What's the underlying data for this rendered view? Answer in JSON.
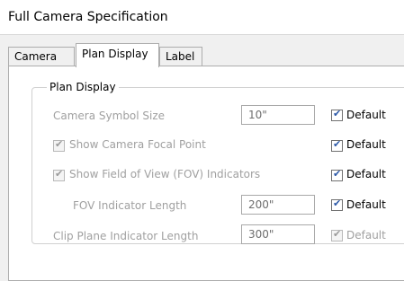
{
  "window": {
    "title": "Full Camera Specification"
  },
  "tabs": [
    {
      "label": "Camera"
    },
    {
      "label": "Plan Display"
    },
    {
      "label": "Label"
    }
  ],
  "group": {
    "label": "Plan Display"
  },
  "rows": {
    "symbol_size": {
      "label": "Camera Symbol Size",
      "value": "10\"",
      "default_label": "Default",
      "default_checked": true
    },
    "focal_point": {
      "label": "Show Camera Focal Point",
      "checked": true,
      "default_label": "Default",
      "default_checked": true
    },
    "fov": {
      "label": "Show Field of View (FOV) Indicators",
      "checked": true,
      "default_label": "Default",
      "default_checked": true
    },
    "fov_length": {
      "label": "FOV Indicator Length",
      "value": "200\"",
      "default_label": "Default",
      "default_checked": true
    },
    "clip_plane": {
      "label": "Clip Plane Indicator Length",
      "value": "300\"",
      "default_label": "Default",
      "default_checked": true
    }
  },
  "colors": {
    "check_blue": "#2c59a8",
    "disabled_text": "#a0a0a0"
  }
}
